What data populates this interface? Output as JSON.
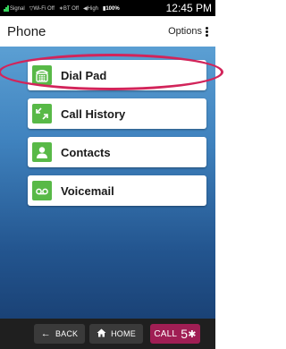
{
  "status_bar": {
    "signal": "Signal",
    "wifi": "Wi-Fi Off",
    "bluetooth": "BT Off",
    "volume": "High",
    "battery": "100%",
    "time": "12:45 PM"
  },
  "header": {
    "title": "Phone",
    "options_label": "Options"
  },
  "menu": {
    "items": [
      {
        "label": "Dial Pad",
        "icon": "dialpad-phone-icon"
      },
      {
        "label": "Call History",
        "icon": "call-history-arrows-icon"
      },
      {
        "label": "Contacts",
        "icon": "contact-person-icon"
      },
      {
        "label": "Voicemail",
        "icon": "voicemail-icon"
      }
    ],
    "highlighted": "Dial Pad"
  },
  "bottom_bar": {
    "back_label": "BACK",
    "home_label": "HOME",
    "call_label": "CALL",
    "call_number": "5"
  },
  "colors": {
    "icon_green": "#58b947",
    "call_button": "#a01e54",
    "highlight_ring": "#d2245a",
    "background_top": "#5b9fd3",
    "background_bottom": "#1a4276"
  }
}
